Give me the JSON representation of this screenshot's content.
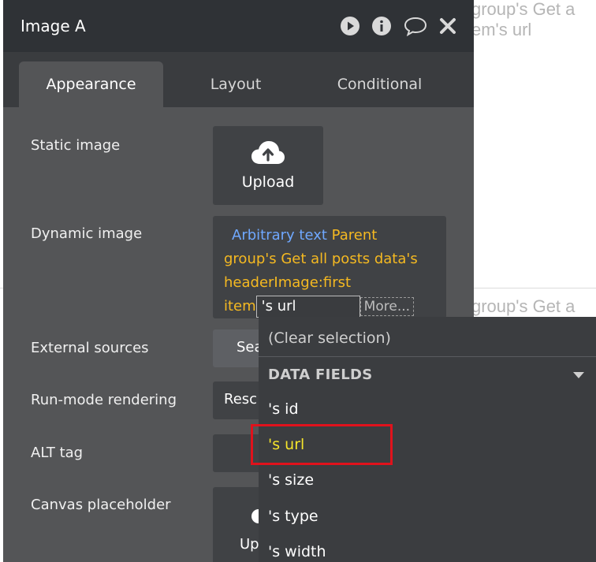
{
  "background": {
    "text_top_line1": "group's Get a",
    "text_top_line2": "em's url",
    "text_mid": "group's Get a"
  },
  "panel": {
    "title": "Image A",
    "header_icons": [
      "play-icon",
      "info-icon",
      "comment-icon",
      "close-icon"
    ]
  },
  "tabs": [
    {
      "label": "Appearance",
      "active": true
    },
    {
      "label": "Layout",
      "active": false
    },
    {
      "label": "Conditional",
      "active": false
    }
  ],
  "fields": {
    "static_image": {
      "label": "Static image",
      "upload_label": "Upload",
      "icon": "cloud-upload-icon"
    },
    "dynamic_image": {
      "label": "Dynamic image",
      "arbitrary": "Arbitrary text",
      "expr_1": "Parent",
      "expr_2": "group's Get all posts data's",
      "expr_3": "headerImage:first",
      "expr_4": "item",
      "chip_value": "'s url",
      "more_label": "More..."
    },
    "external_sources": {
      "label": "External sources",
      "value": "Sea"
    },
    "run_mode": {
      "label": "Run-mode rendering",
      "value": "Resc"
    },
    "alt_tag": {
      "label": "ALT tag"
    },
    "canvas_placeholder": {
      "label": "Canvas placeholder",
      "value": "Up"
    }
  },
  "dropdown": {
    "clear_label": "(Clear selection)",
    "section_label": "DATA FIELDS",
    "items": [
      {
        "label": "'s id",
        "selected": false
      },
      {
        "label": "'s url",
        "selected": true
      },
      {
        "label": "'s size",
        "selected": false
      },
      {
        "label": "'s type",
        "selected": false
      },
      {
        "label": "'s width",
        "selected": false
      }
    ]
  },
  "colors": {
    "panel_bg": "#545557",
    "header_bg": "#2f3236",
    "dropdown_bg": "#3b3d40",
    "expression_orange": "#f5b921",
    "arbitrary_blue": "#6fa8ff",
    "selected_yellow": "#f5e52b",
    "highlight_red": "#e0121c"
  }
}
